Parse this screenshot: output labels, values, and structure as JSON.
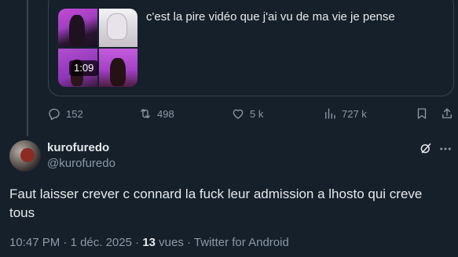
{
  "quoted_tweet": {
    "text": "c'est la pire vidéo que j'ai vu de ma vie je pense",
    "video_duration": "1:09"
  },
  "actions": {
    "replies": "152",
    "retweets": "498",
    "likes": "5 k",
    "views": "727 k"
  },
  "author": {
    "display_name": "kurofuredo",
    "handle": "@kurofuredo"
  },
  "tweet": {
    "text": "Faut laisser crever c connard la fuck leur admission a lhosto qui creve tous"
  },
  "meta": {
    "time": "10:47 PM",
    "sep1": " · ",
    "date": "1 déc. 2025",
    "sep2": " · ",
    "views_count": "13",
    "views_label": " vues",
    "sep3": " · ",
    "source": "Twitter for Android"
  },
  "colors": {
    "background": "#15202b",
    "text_primary": "#e7e9ea",
    "text_secondary": "#8b98a5",
    "border": "#38444d"
  }
}
